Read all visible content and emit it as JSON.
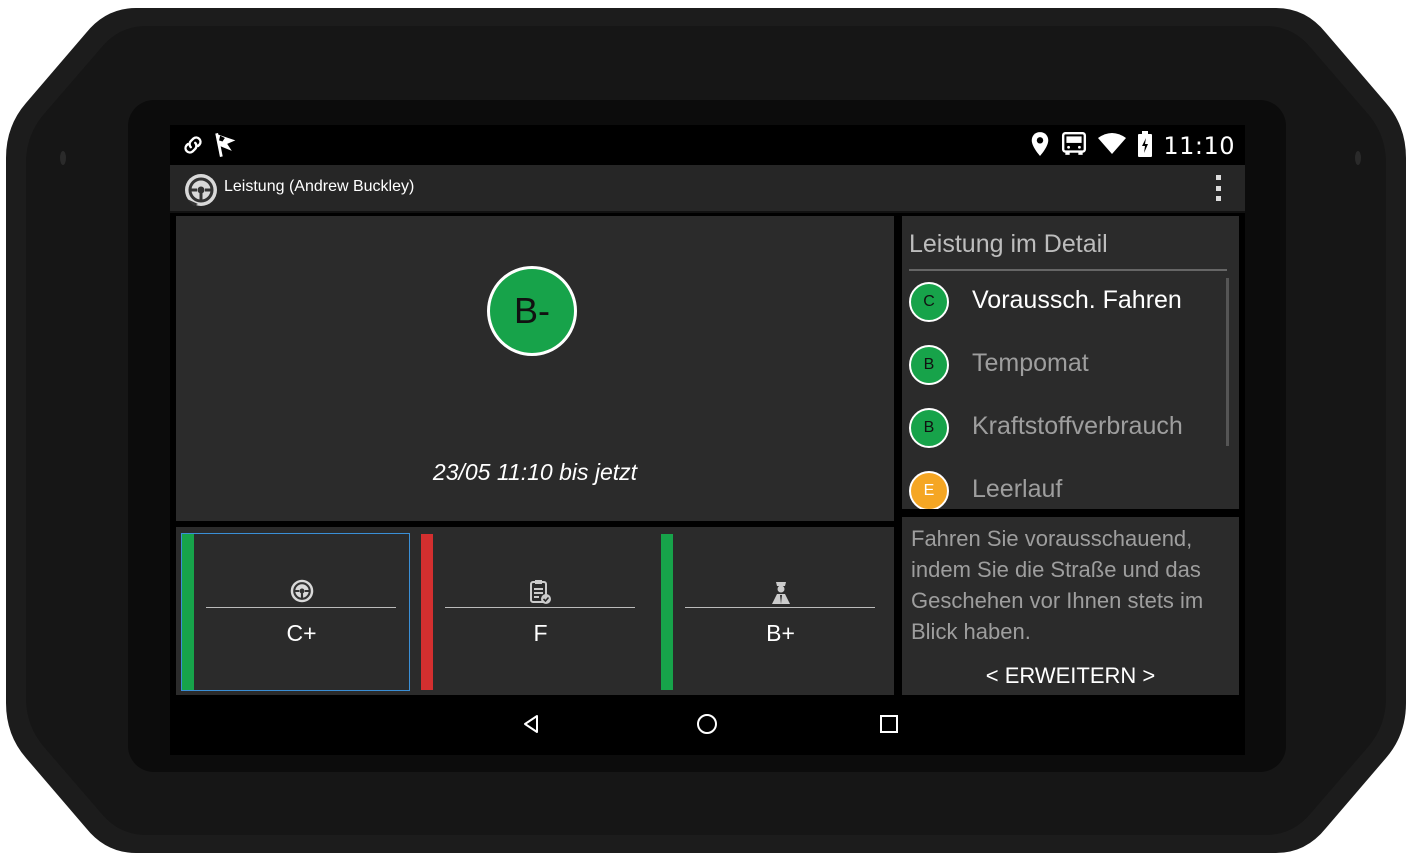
{
  "status_bar": {
    "left_icons": [
      "link-icon",
      "flag-icon"
    ],
    "right_icons": [
      "location-pin-icon",
      "truck-icon",
      "wifi-icon",
      "battery-charging-icon"
    ],
    "time": "11:10"
  },
  "app_bar": {
    "title": "Leistung (Andrew Buckley)",
    "icon": "steering-wheel-icon",
    "menu_icon": "overflow-menu-icon"
  },
  "overall": {
    "grade": "B-",
    "grade_color": "#17a34a",
    "period": "23/05 11:10 bis jetzt"
  },
  "detail": {
    "title": "Leistung im Detail",
    "items": [
      {
        "grade": "C",
        "label": "Voraussch. Fahren",
        "color": "#17a34a",
        "active": true
      },
      {
        "grade": "B",
        "label": "Tempomat",
        "color": "#17a34a",
        "active": false
      },
      {
        "grade": "B",
        "label": "Kraftstoffverbrauch",
        "color": "#17a34a",
        "active": false
      },
      {
        "grade": "E",
        "label": "Leerlauf",
        "color": "#f5a623",
        "active": false
      }
    ]
  },
  "tip": {
    "text": "Fahren Sie vorausschauend, indem Sie die Straße und das Geschehen vor Ihnen stets im Blick haben.",
    "expand_label": "< ERWEITERN >"
  },
  "categories": [
    {
      "icon": "steering-wheel-icon",
      "grade": "C+",
      "bar_color": "#17a34a",
      "selected": true
    },
    {
      "icon": "clipboard-check-icon",
      "grade": "F",
      "bar_color": "#d32f2f",
      "selected": false
    },
    {
      "icon": "driver-icon",
      "grade": "B+",
      "bar_color": "#17a34a",
      "selected": false
    }
  ],
  "nav_bar": {
    "buttons": [
      "back-icon",
      "home-icon",
      "recents-icon"
    ]
  }
}
